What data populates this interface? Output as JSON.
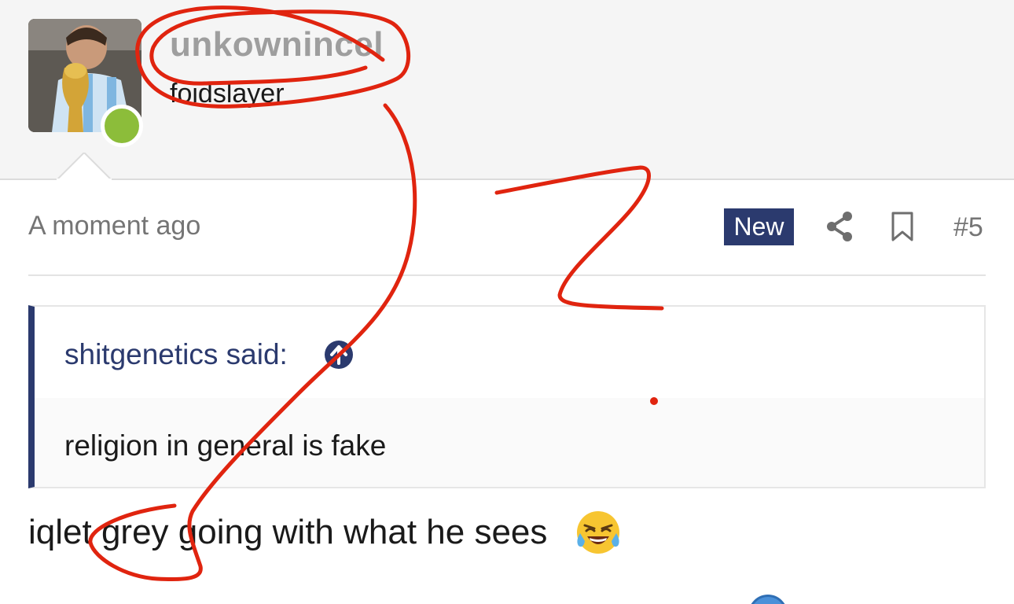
{
  "user": {
    "username": "unkownincel",
    "title": "foidslayer",
    "online": true
  },
  "post": {
    "timestamp": "A moment ago",
    "badge": "New",
    "number": "#5",
    "body": "iqlet grey going with what he sees"
  },
  "quote": {
    "author": "shitgenetics said:",
    "text": "religion in general is fake"
  },
  "icons": {
    "share": "share-icon",
    "bookmark": "bookmark-icon",
    "quote_jump": "arrow-up-circle-icon",
    "emoji": "crying-laughing-emoji"
  },
  "colors": {
    "accent": "#2b3a6e",
    "online": "#8cbd3a",
    "annotation": "#e0240f"
  }
}
